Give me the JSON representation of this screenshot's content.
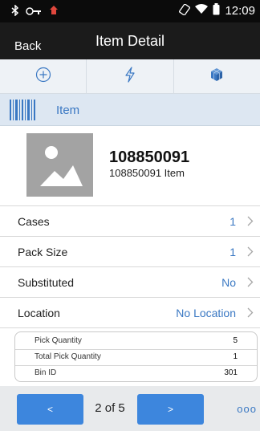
{
  "status_bar": {
    "time": "12:09",
    "icons": [
      "bluetooth-icon",
      "key-icon",
      "sync-icon",
      "rotation-icon",
      "wifi-icon",
      "battery-icon"
    ]
  },
  "nav": {
    "back_label": "Back",
    "title": "Item Detail"
  },
  "toolbar": {
    "items": [
      "add-icon",
      "flash-icon",
      "cube-icon"
    ],
    "icon_color": "#3a78c3"
  },
  "section": {
    "label": "Item",
    "icon": "barcode-icon"
  },
  "item": {
    "number": "108850091",
    "description": "108850091 Item",
    "image_icon": "image-placeholder-icon"
  },
  "details": [
    {
      "label": "Cases",
      "value": "1"
    },
    {
      "label": "Pack Size",
      "value": "1"
    },
    {
      "label": "Substituted",
      "value": "No"
    },
    {
      "label": "Location",
      "value": "No Location"
    }
  ],
  "summary": [
    {
      "label": "Pick Quantity",
      "value": "5"
    },
    {
      "label": "Total Pick Quantity",
      "value": "1"
    },
    {
      "label": "Bin ID",
      "value": "301"
    }
  ],
  "footer": {
    "prev_label": "<",
    "page_indicator": "2 of 5",
    "next_label": ">",
    "more_label": "ooo"
  },
  "colors": {
    "accent": "#3a78c3",
    "button": "#3d86dd",
    "nav_bg": "#1b1b1b"
  }
}
